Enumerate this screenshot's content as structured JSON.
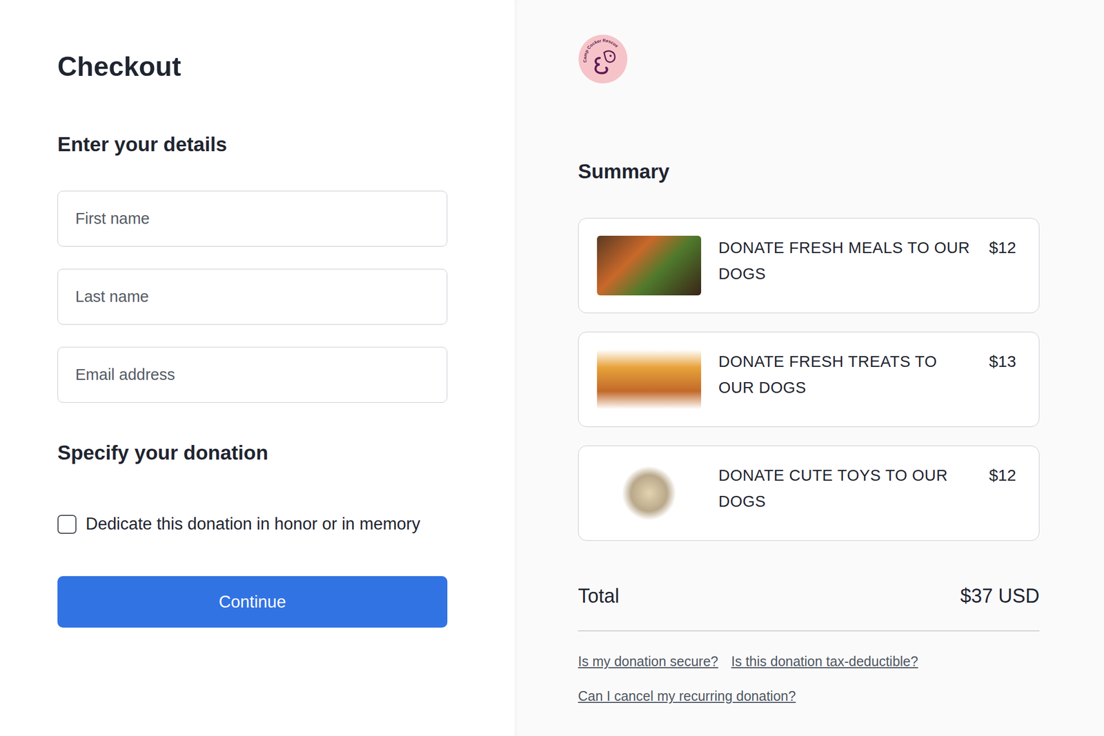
{
  "title": "Checkout",
  "details": {
    "heading": "Enter your details",
    "fields": [
      {
        "placeholder": "First name"
      },
      {
        "placeholder": "Last name"
      },
      {
        "placeholder": "Email address"
      }
    ]
  },
  "donation": {
    "heading": "Specify your donation",
    "dedicate": {
      "label": "Dedicate this donation in honor or in memory",
      "checked": false
    }
  },
  "continue_button": "Continue",
  "logo": {
    "text": "Camp Cocker Rescue"
  },
  "summary": {
    "heading": "Summary",
    "items": [
      {
        "name": "DONATE FRESH MEALS TO OUR DOGS",
        "price": "$12"
      },
      {
        "name": "DONATE FRESH TREATS TO OUR DOGS",
        "price": "$13"
      },
      {
        "name": "DONATE CUTE TOYS TO OUR DOGS",
        "price": "$12"
      }
    ],
    "total_label": "Total",
    "total": "$37 USD",
    "links": [
      [
        "Is my donation secure?",
        "Is this donation tax-deductible?"
      ],
      [
        "Can I cancel my recurring donation?"
      ]
    ]
  }
}
